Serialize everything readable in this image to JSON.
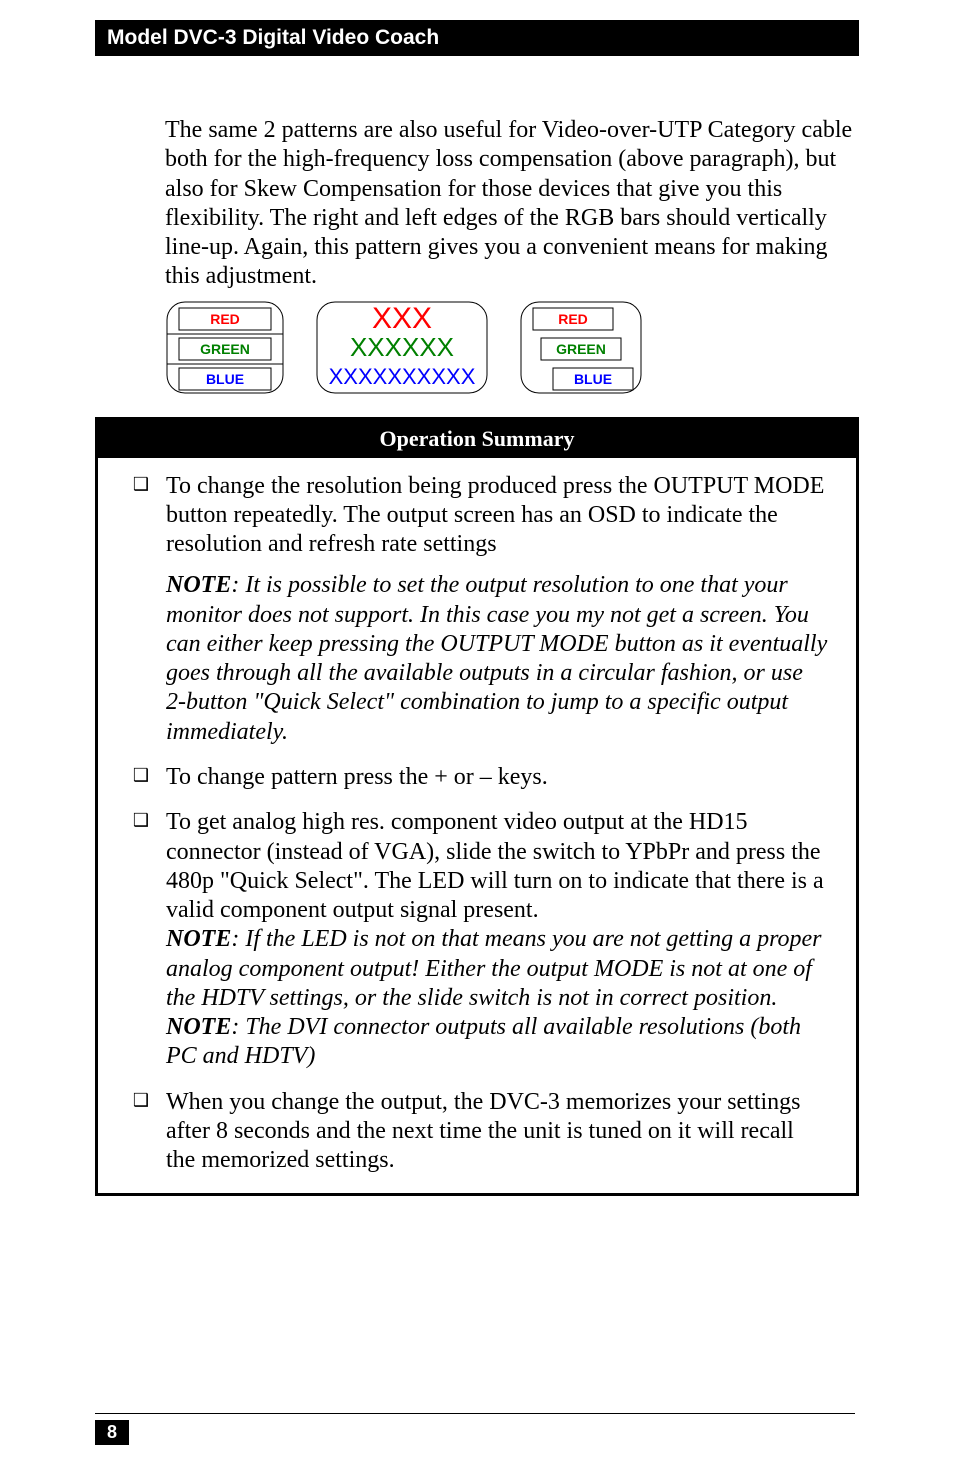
{
  "header": {
    "title": "Model DVC-3 Digital Video Coach"
  },
  "intro": "The same 2 patterns are also useful for Video-over-UTP Category cable both for the high-frequency loss compensation (above paragraph), but also for Skew Compensation for those devices that give you this flexibility. The right and left edges of the RGB bars should vertically line-up. Again, this pattern gives you a convenient means for making this adjustment.",
  "diagram": {
    "labels": [
      "RED",
      "GREEN",
      "BLUE"
    ],
    "colors": {
      "RED": "#ff0000",
      "GREEN": "#008000",
      "BLUE": "#0000ff"
    }
  },
  "operation_summary": {
    "title": "Operation Summary",
    "items": [
      {
        "bullet": "❑",
        "text": "To change the resolution being produced press the OUTPUT MODE button repeatedly. The output screen has an OSD to indicate the resolution and refresh rate settings",
        "note": {
          "label": "NOTE",
          "body": ": It is possible to set the output resolution to one that your monitor does not support. In this case you my not get a screen. You can either keep pressing the OUTPUT MODE button as it eventually goes through all the available outputs in a circular fashion, or use 2-button \"Quick Select\" combination to jump to a specific output immediately."
        }
      },
      {
        "bullet": "❑",
        "text": "To change pattern press the + or – keys."
      },
      {
        "bullet": "❑",
        "text": "To get analog high res. component video output at the HD15 connector (instead of VGA), slide the switch to YPbPr and press the 480p \"Quick Select\". The LED will turn on to indicate that there is a valid component output signal present.",
        "inline_notes": [
          {
            "label": "NOTE",
            "body": ": If the LED is not on that means you are not getting a proper analog component output! Either the output MODE is not at one of the HDTV settings, or the slide switch is not in correct position."
          },
          {
            "label": "NOTE",
            "body": ": The DVI connector outputs all available resolutions (both PC and HDTV)"
          }
        ]
      },
      {
        "bullet": "❑",
        "text": "When you change the output, the DVC-3 memorizes your settings after 8 seconds and the next time the unit is tuned on it will recall the memorized settings."
      }
    ]
  },
  "footer": {
    "page": "8"
  }
}
